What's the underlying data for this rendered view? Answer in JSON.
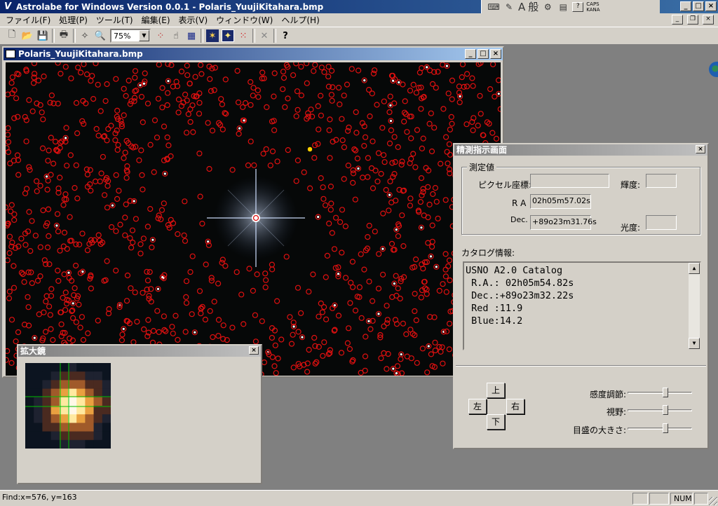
{
  "window": {
    "title": "Astrolabe for Windows Version 0.0.1 - Polaris_YuujiKitahara.bmp",
    "icon_glyph": "V",
    "controls": {
      "minimize": "_",
      "maximize": "□",
      "close": "×"
    }
  },
  "language_bar": {
    "ime_mode": "A",
    "ime_kanji": "般",
    "caps": "CAPS",
    "kana": "KANA",
    "help": "?"
  },
  "menu": {
    "items": [
      {
        "label": "ファイル(F)"
      },
      {
        "label": "処理(P)"
      },
      {
        "label": "ツール(T)"
      },
      {
        "label": "編集(E)"
      },
      {
        "label": "表示(V)"
      },
      {
        "label": "ウィンドウ(W)"
      },
      {
        "label": "ヘルプ(H)"
      }
    ]
  },
  "toolbar": {
    "buttons": [
      {
        "name": "new-icon",
        "glyph": "🗋"
      },
      {
        "name": "open-icon",
        "glyph": "📂"
      },
      {
        "name": "save-icon",
        "glyph": "💾"
      },
      {
        "name": "print-icon",
        "glyph": "🖶"
      },
      {
        "name": "sparkle-icon",
        "glyph": "✧"
      },
      {
        "name": "zoom-icon",
        "glyph": "🔍"
      }
    ],
    "zoom_value": "75%",
    "zoom_arrow": "▼",
    "buttons_after": [
      {
        "name": "dots-color-icon",
        "glyph": "⁘"
      },
      {
        "name": "hand-icon",
        "glyph": "☝"
      },
      {
        "name": "starmap-icon",
        "glyph": "▦"
      },
      {
        "name": "star-grid-icon",
        "glyph": "✶"
      },
      {
        "name": "star-target-icon",
        "glyph": "✦"
      },
      {
        "name": "circles-icon",
        "glyph": "⁙"
      },
      {
        "name": "close-x-icon",
        "glyph": "✕"
      },
      {
        "name": "help-icon",
        "glyph": "?"
      }
    ]
  },
  "image_window": {
    "title": "Polaris_YuujiKitahara.bmp"
  },
  "measure_panel": {
    "title": "精測指示画面",
    "close": "×",
    "group_label": "測定値",
    "pixel_label": "ピクセル座標:",
    "pixel_value": "",
    "brightness_label": "輝度:",
    "brightness_value": "",
    "ra_label": "R A",
    "ra_value": "02h05m57.02s",
    "dec_label": "Dec.",
    "dec_value": "+89o23m31.76s",
    "magnitude_label": "光度:",
    "magnitude_value": "",
    "catalog_label": "カタログ情報:",
    "catalog_lines": [
      "USNO A2.0 Catalog",
      " R.A.: 02h05m54.82s",
      " Dec.:+89o23m32.22s",
      " Red :11.9",
      " Blue:14.2"
    ],
    "scroll_up": "▲",
    "scroll_down": "▼",
    "btn_up": "上",
    "btn_left": "左",
    "btn_right": "右",
    "btn_down": "下",
    "sliders": [
      {
        "label": "感度調節:",
        "value": 0.6
      },
      {
        "label": "視野:",
        "value": 0.6
      },
      {
        "label": "目盛の大きさ:",
        "value": 0.6
      }
    ]
  },
  "magnifier": {
    "title": "拡大鏡",
    "close": "×"
  },
  "statusbar": {
    "text": "Find:x=576, y=163",
    "num": "NUM"
  },
  "colors": {
    "title_active": "#0a246a",
    "marker_red": "#e01010",
    "face": "#d4d0c8"
  }
}
